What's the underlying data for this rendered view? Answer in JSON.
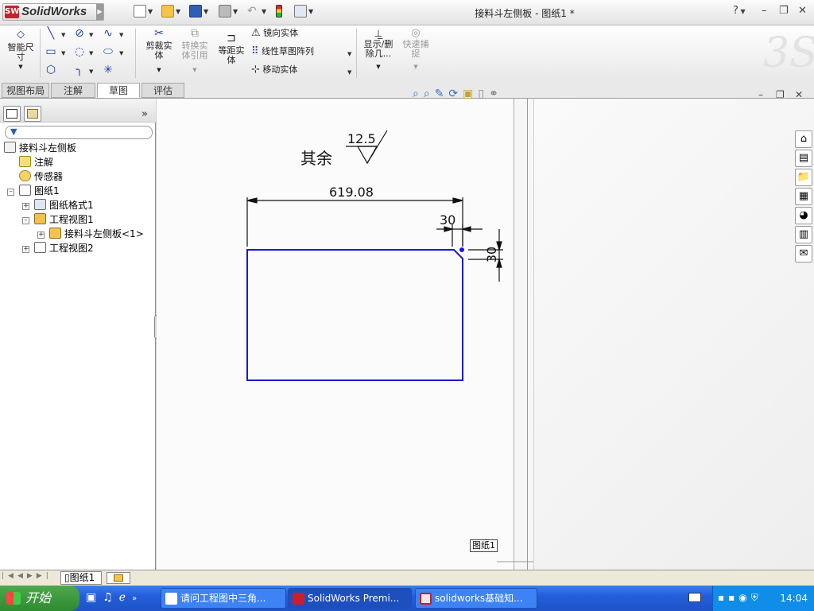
{
  "app": {
    "logo_text": "SolidWorks",
    "window_title": "接料斗左侧板 - 图纸1 *",
    "help": "?"
  },
  "ribbon": {
    "smart_dim": "智能尺寸",
    "trim": "剪裁实体",
    "convert": "转换实体引用",
    "offset": "等距实体",
    "mirror": "镜向实体",
    "linear_pattern": "线性草图阵列",
    "move": "移动实体",
    "show_hide": "显示/删除几...",
    "quick_snap": "快速捕捉"
  },
  "tabs": [
    {
      "label": "视图布局"
    },
    {
      "label": "注解"
    },
    {
      "label": "草图"
    },
    {
      "label": "评估"
    }
  ],
  "tree": [
    {
      "label": "接料斗左侧板"
    },
    {
      "label": "注解"
    },
    {
      "label": "传感器"
    },
    {
      "label": "图纸1"
    },
    {
      "label": "图纸格式1"
    },
    {
      "label": "工程视图1"
    },
    {
      "label": "接料斗左侧板<1>"
    },
    {
      "label": "工程视图2"
    }
  ],
  "drawing": {
    "rest_label": "其余",
    "roughness": "12.5",
    "dim_width": "619.08",
    "dim_chamfer_h": "30",
    "dim_chamfer_v": "30",
    "sheet_label": "图纸1",
    "line_color": "#1a1acd"
  },
  "status": {
    "sheet_tab": "图纸1"
  },
  "taskbar": {
    "start": "开始",
    "items": [
      {
        "label": "请问工程图中三角..."
      },
      {
        "label": "SolidWorks Premi..."
      },
      {
        "label": "solidworks基础知..."
      }
    ],
    "clock": "14:04"
  }
}
